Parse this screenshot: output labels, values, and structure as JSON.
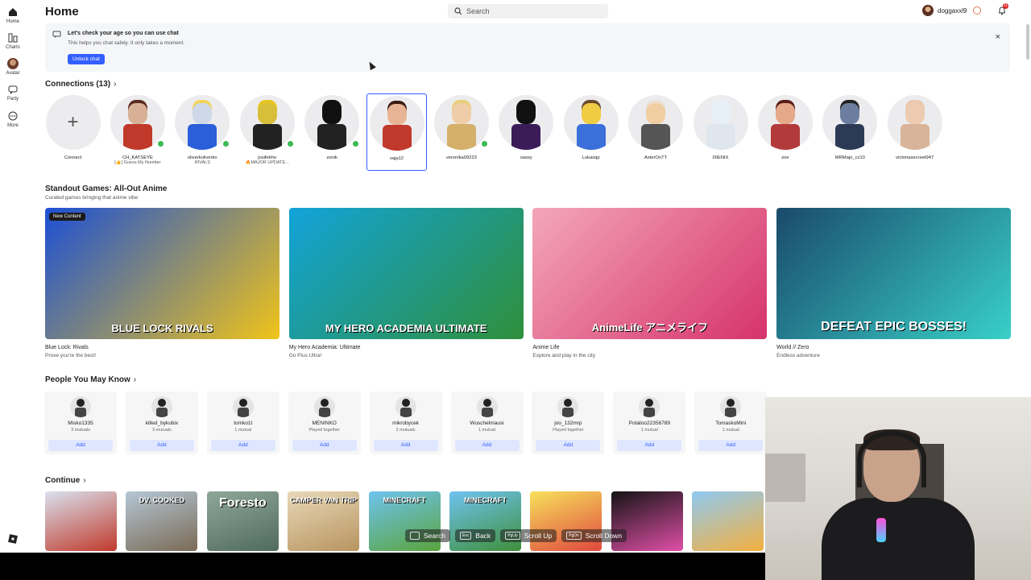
{
  "sidebar": {
    "items": [
      {
        "label": "Home",
        "icon": "home-icon"
      },
      {
        "label": "Charts",
        "icon": "charts-icon"
      },
      {
        "label": "Avatar",
        "icon": "avatar-icon"
      },
      {
        "label": "Party",
        "icon": "party-icon"
      },
      {
        "label": "More",
        "icon": "more-icon"
      }
    ]
  },
  "header": {
    "title": "Home",
    "search_placeholder": "Search",
    "username": "doggaxxl9",
    "notification_count": "11"
  },
  "chat_banner": {
    "title": "Let's check your age so you can use chat",
    "subtitle": "This helps you chat safely. It only takes a moment.",
    "button": "Unlock chat",
    "close": "×"
  },
  "connections": {
    "title": "Connections (13)",
    "items": [
      {
        "name": "Connect",
        "status": ""
      },
      {
        "name": "CH_KATSEYE",
        "status": "[👍] Guess My Number"
      },
      {
        "name": "oliverkoliverko",
        "status": "RIVALS"
      },
      {
        "name": "josifekho",
        "status": "🔥MAJOR UPDATE..."
      },
      {
        "name": "zonik",
        "status": ""
      },
      {
        "name": "vaja12",
        "status": ""
      },
      {
        "name": "veronika09223",
        "status": ""
      },
      {
        "name": "sassy",
        "status": ""
      },
      {
        "name": "Lukasqp",
        "status": ""
      },
      {
        "name": "AxterOnTT",
        "status": ""
      },
      {
        "name": "00ENIX",
        "status": ""
      },
      {
        "name": "zoe",
        "status": ""
      },
      {
        "name": "MRMajo_cz10",
        "status": ""
      },
      {
        "name": "victoriasecreet947",
        "status": ""
      }
    ]
  },
  "standout": {
    "title": "Standout Games: All-Out Anime",
    "subtitle": "Curated games bringing that anime vibe",
    "games": [
      {
        "name": "Blue Lock: Rivals",
        "desc": "Prove you're the best!",
        "badge": "New Content",
        "art_text": "BLUE LOCK RIVALS",
        "colors": [
          "#1b4fd6",
          "#f0c419"
        ]
      },
      {
        "name": "My Hero Academia: Ultimate",
        "desc": "Go Plus Ultra!",
        "badge": "",
        "art_text": "MY HERO ACADEMIA ULTIMATE",
        "colors": [
          "#12a3d9",
          "#2f8f3b"
        ]
      },
      {
        "name": "Anime Life",
        "desc": "Explore and play in the city",
        "badge": "",
        "art_text": "AnimeLife アニメライフ",
        "colors": [
          "#f3a7b8",
          "#d6336c"
        ]
      },
      {
        "name": "World // Zero",
        "desc": "Endless adventure",
        "badge": "",
        "art_text": "DEFEAT EPIC BOSSES!",
        "colors": [
          "#1a4a6b",
          "#38d0c8"
        ]
      }
    ]
  },
  "people": {
    "title": "People You May Know",
    "add_label": "Add",
    "items": [
      {
        "name": "Misko1335",
        "mutual": "3 mutuals"
      },
      {
        "name": "killed_bykubix",
        "mutual": "3 mutuals"
      },
      {
        "name": "tomko1t",
        "mutual": "1 mutual"
      },
      {
        "name": "MENINKO",
        "mutual": "Played together"
      },
      {
        "name": "mikrobycek",
        "mutual": "2 mutuals"
      },
      {
        "name": "Wuschelmausi",
        "mutual": "1 mutual"
      },
      {
        "name": "joo_132mrp",
        "mutual": "Played together"
      },
      {
        "name": "Potatoo22356789",
        "mutual": "1 mutual"
      },
      {
        "name": "TomaskoMini",
        "mutual": "1 mutual"
      }
    ]
  },
  "continue": {
    "title": "Continue",
    "tiles": [
      {
        "label": "",
        "colors": [
          "#d9e2ef",
          "#c0392b"
        ]
      },
      {
        "label": "DV. COOKED",
        "colors": [
          "#b5c7d6",
          "#7a6a55"
        ]
      },
      {
        "label": "Foresto",
        "colors": [
          "#8fa79b",
          "#4f6b5d"
        ]
      },
      {
        "label": "CAMPER VAN TRIP",
        "colors": [
          "#e8d8b8",
          "#b89460"
        ]
      },
      {
        "label": "MINECRAFT",
        "colors": [
          "#6ec3f0",
          "#5aa43c"
        ]
      },
      {
        "label": "MINECRAFT",
        "colors": [
          "#6ec3f0",
          "#3f8f3a"
        ]
      },
      {
        "label": "",
        "colors": [
          "#f7e15b",
          "#e0483e"
        ]
      },
      {
        "label": "",
        "colors": [
          "#141414",
          "#e14fa8"
        ]
      },
      {
        "label": "",
        "colors": [
          "#8fc9f2",
          "#f4b03e"
        ]
      }
    ]
  },
  "hints": [
    {
      "key": "",
      "label": "Search"
    },
    {
      "key": "Esc",
      "label": "Back"
    },
    {
      "key": "PgUp",
      "label": "Scroll Up"
    },
    {
      "key": "PgDn",
      "label": "Scroll Down"
    }
  ],
  "colors": {
    "accent": "#335fff",
    "online": "#3cba54"
  }
}
